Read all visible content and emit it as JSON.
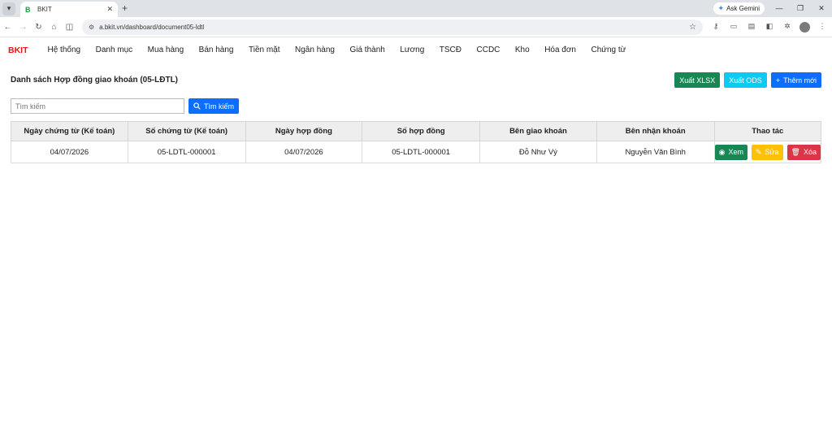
{
  "browser": {
    "tab_title": "BKIT",
    "favicon": "B",
    "url": "a.bkit.vn/dashboard/document05-ldtl",
    "ask_gemini": "Ask Gemini"
  },
  "app": {
    "brand": "BKIT",
    "menu": [
      "Hệ thống",
      "Danh mục",
      "Mua hàng",
      "Bán hàng",
      "Tiền mặt",
      "Ngân hàng",
      "Giá thành",
      "Lương",
      "TSCĐ",
      "CCDC",
      "Kho",
      "Hóa đơn",
      "Chứng từ"
    ]
  },
  "page": {
    "title": "Danh sách Hợp đồng giao khoán (05-LĐTL)",
    "export_xlsx": "Xuất XLSX",
    "export_ods": "Xuất ODS",
    "add_new": "Thêm mới",
    "search_placeholder": "Tìm kiếm",
    "search_button": "Tìm kiếm"
  },
  "table": {
    "headers": [
      "Ngày chứng từ (Kế toán)",
      "Số chứng từ (Kế toán)",
      "Ngày hợp đồng",
      "Số hợp đồng",
      "Bên giao khoán",
      "Bên nhận khoán",
      "Thao tác"
    ],
    "rows": [
      {
        "date_doc": "04/07/2026",
        "doc_no": "05-LDTL-000001",
        "contract_date": "04/07/2026",
        "contract_no": "05-LDTL-000001",
        "assigner": "Đỗ Như Vý",
        "assignee": "Nguyễn Văn Bình"
      }
    ],
    "actions": {
      "view": "Xem",
      "edit": "Sửa",
      "delete": "Xóa"
    }
  },
  "colors": {
    "brand": "#ee1111",
    "green": "#198754",
    "cyan": "#0dcaf0",
    "blue": "#0d6efd",
    "yellow": "#ffc107",
    "red": "#dc3545"
  }
}
